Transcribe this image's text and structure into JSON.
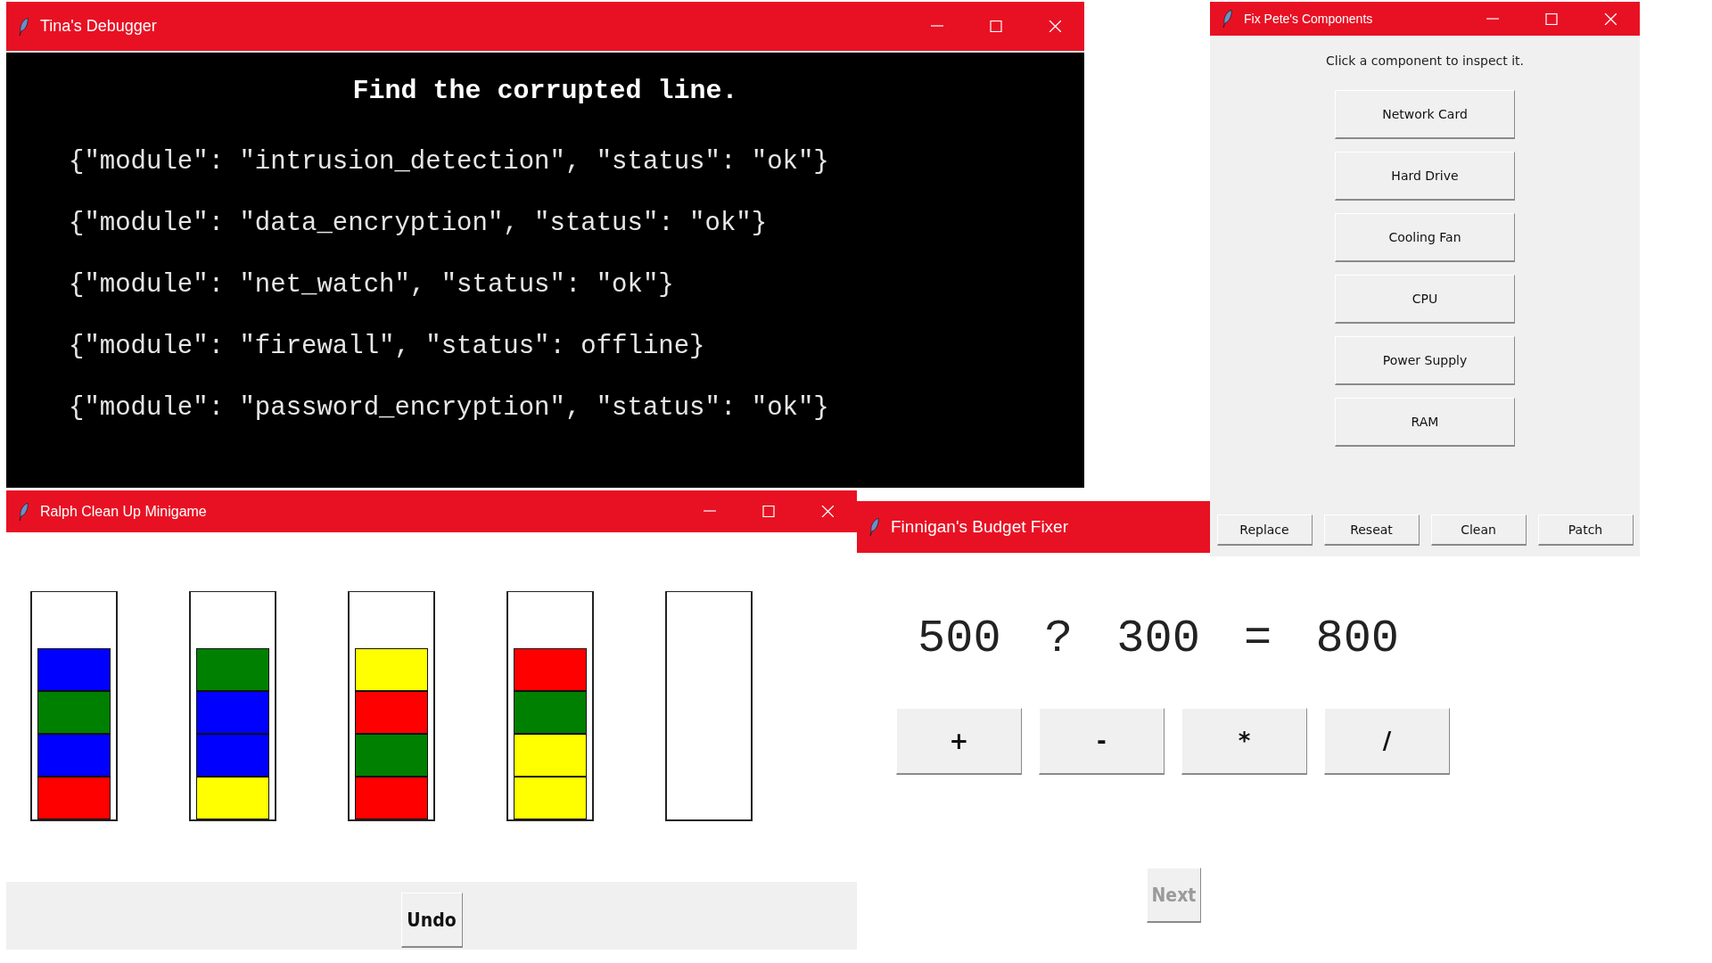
{
  "windows": [
    {
      "kind": "debugger",
      "title": "Tina's Debugger",
      "heading": "Find the corrupted line.",
      "lines": [
        "{\"module\": \"intrusion_detection\", \"status\": \"ok\"}",
        "{\"module\": \"data_encryption\", \"status\": \"ok\"}",
        "{\"module\": \"net_watch\", \"status\": \"ok\"}",
        "{\"module\": \"firewall\", \"status\": offline}",
        "{\"module\": \"password_encryption\", \"status\": \"ok\"}"
      ]
    },
    {
      "kind": "sorter",
      "title": "Ralph Clean Up Minigame",
      "tubes": [
        {
          "kind": "filled",
          "blocks": [
            {
              "color": "#0000ff"
            },
            {
              "color": "#008000"
            },
            {
              "color": "#0000ff"
            },
            {
              "color": "#ff0000"
            }
          ]
        },
        {
          "kind": "filled",
          "blocks": [
            {
              "color": "#008000"
            },
            {
              "color": "#0000ff"
            },
            {
              "color": "#0000ff"
            },
            {
              "color": "#ffff00"
            }
          ]
        },
        {
          "kind": "filled",
          "blocks": [
            {
              "color": "#ffff00"
            },
            {
              "color": "#ff0000"
            },
            {
              "color": "#008000"
            },
            {
              "color": "#ff0000"
            }
          ]
        },
        {
          "kind": "filled",
          "blocks": [
            {
              "color": "#ff0000"
            },
            {
              "color": "#008000"
            },
            {
              "color": "#ffff00"
            },
            {
              "color": "#ffff00"
            }
          ]
        },
        {
          "kind": "empty"
        }
      ],
      "undo_button": "Undo"
    },
    {
      "kind": "budget",
      "title": "Finnigan's Budget Fixer",
      "equation": "500 ? 300 = 800",
      "operators": [
        "+",
        "-",
        "*",
        "/"
      ],
      "next_button": {
        "label": "Next",
        "disabled": true
      }
    },
    {
      "kind": "components",
      "title": "Fix Pete's Components",
      "prompt": "Click a component to inspect it.",
      "components": [
        "Network Card",
        "Hard Drive",
        "Cooling Fan",
        "CPU",
        "Power Supply",
        "RAM"
      ],
      "actions": [
        "Replace",
        "Reseat",
        "Clean",
        "Patch"
      ]
    }
  ]
}
